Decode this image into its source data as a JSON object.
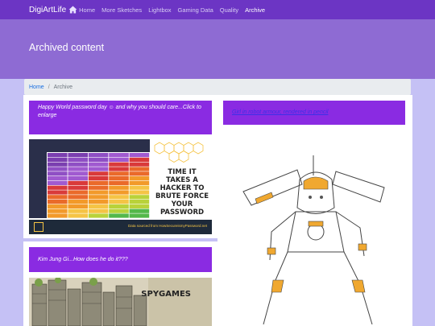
{
  "nav": {
    "brand": "DigiArtLife",
    "home": "Home",
    "items": [
      "More Sketches",
      "Lightbox",
      "Gaming Data",
      "Quality",
      "Archive"
    ]
  },
  "jumbotron": {
    "title": "Archived content"
  },
  "breadcrumb": {
    "home": "Home",
    "current": "Archive"
  },
  "posts": [
    {
      "caption": "Happy World password day ☺ and why you should care...Click to enlarge"
    },
    {
      "caption": "Kim Jung Gi...How does he do it???"
    },
    {
      "caption": "Girl in robot armour, rendered in pencil"
    }
  ],
  "password_image": {
    "headline": "TIME IT TAKES A HACKER TO BRUTE FORCE YOUR PASSWORD",
    "credit": "Data sourced from HowSecureismyPassword.net",
    "column_headers": [
      "Number of Characters",
      "Numbers Only",
      "Lowercase Letters",
      "Upper and Lowercase Letters",
      "Numbers, Upper and Lowercase Letters",
      "Numbers, Upper and Lowercase Letters, Symbols"
    ]
  },
  "game_image": {
    "title": "SPYGAMES"
  },
  "colors": {
    "navbar": "#6c35c4",
    "jumbotron": "#8e6bd3",
    "page_bg": "#c5c1f5",
    "card_header": "#8a2be2"
  }
}
